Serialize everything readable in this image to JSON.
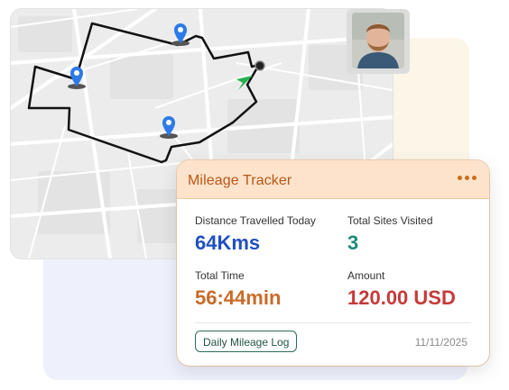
{
  "card": {
    "title": "Mileage Tracker",
    "menu_icon": "more-dots-icon",
    "stats": {
      "distance": {
        "label": "Distance Travelled Today",
        "value": "64Kms",
        "color": "#1f4fbf"
      },
      "sites": {
        "label": "Total Sites Visited",
        "value": "3",
        "color": "#1d8a7b"
      },
      "time": {
        "label": "Total Time",
        "value": "56:44min",
        "color": "#c96a2a"
      },
      "amount": {
        "label": "Amount",
        "value": "120.00 USD",
        "color": "#c53a3a"
      }
    },
    "log_button": "Daily Mileage Log",
    "date": "11/11/2025"
  },
  "map": {
    "markers": [
      "map-pin-icon",
      "map-pin-icon",
      "map-pin-icon"
    ],
    "route_color": "#111111",
    "pin_color": "#2e7be8",
    "arrow_color": "#22b24c"
  },
  "user": {
    "avatar": "user-avatar"
  }
}
